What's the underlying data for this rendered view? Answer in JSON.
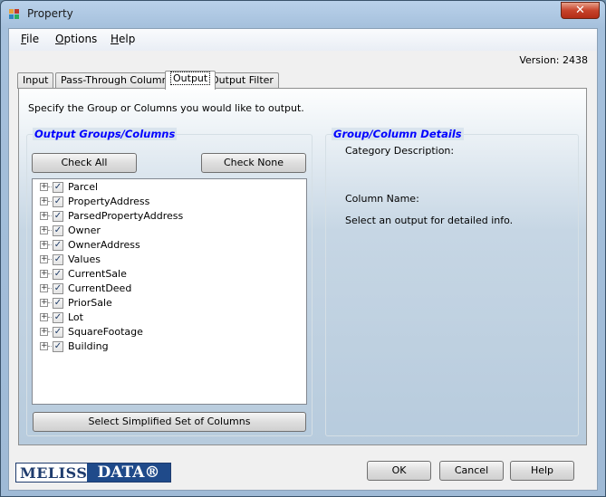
{
  "window": {
    "title": "Property",
    "close_label": "✕"
  },
  "menu": [
    {
      "label": "File",
      "accel": "F",
      "rest": "ile"
    },
    {
      "label": "Options",
      "accel": "O",
      "rest": "ptions"
    },
    {
      "label": "Help",
      "accel": "H",
      "rest": "elp"
    }
  ],
  "version": "Version: 2438",
  "tabs": [
    {
      "label": "Input"
    },
    {
      "label": "Pass-Through Columns"
    },
    {
      "label": "Output"
    },
    {
      "label": "Output Filter"
    }
  ],
  "instructions": "Specify the Group or Columns you would like to output.",
  "output_groups": {
    "title": "Output Groups/Columns",
    "check_all": "Check All",
    "check_none": "Check None",
    "items": [
      "Parcel",
      "PropertyAddress",
      "ParsedPropertyAddress",
      "Owner",
      "OwnerAddress",
      "Values",
      "CurrentSale",
      "CurrentDeed",
      "PriorSale",
      "Lot",
      "SquareFootage",
      "Building"
    ],
    "simplified_button": "Select Simplified Set of Columns"
  },
  "details": {
    "title": "Group/Column Details",
    "category_label": "Category Description:",
    "column_label": "Column Name:",
    "hint": "Select an output for detailed info."
  },
  "footer": {
    "ok": "OK",
    "cancel": "Cancel",
    "help": "Help",
    "logo_left": "MELISSA",
    "logo_right": "DATA®"
  },
  "colors": {
    "group_title": "#0000ff",
    "logo_blue": "#1f4a8a"
  }
}
